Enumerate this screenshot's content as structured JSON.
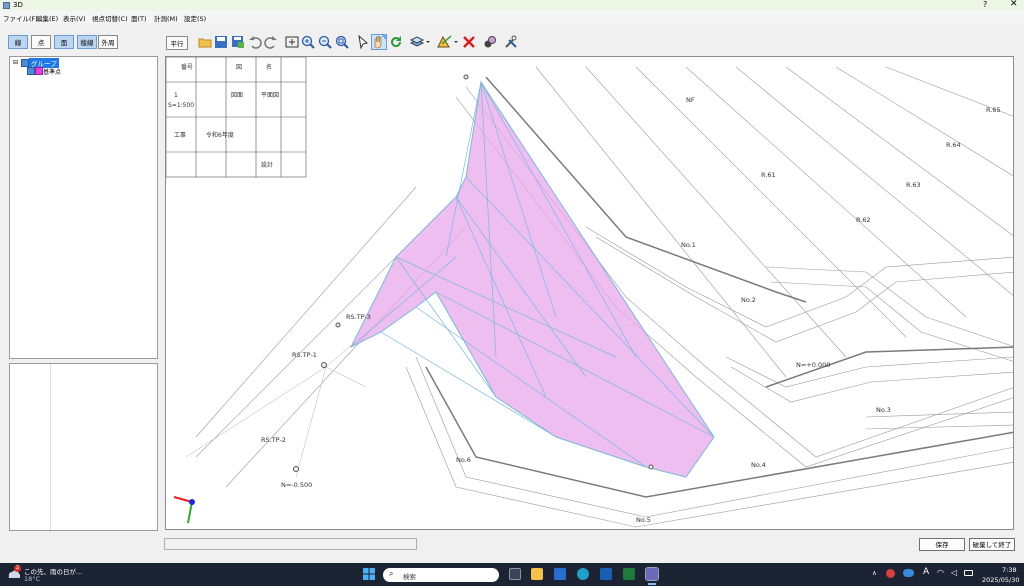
{
  "window": {
    "title": "3D",
    "help_label": "?",
    "close_label": "✕"
  },
  "menu": [
    "ファイル(F)",
    "編集(E)",
    "表示(V)",
    "視点切替(C)",
    "面(T)",
    "計測(M)",
    "設定(S)"
  ],
  "mode_buttons": [
    "線",
    "点",
    "面",
    "稜線",
    "外周"
  ],
  "view_button": "平行",
  "tree": {
    "root": "グループ",
    "child": "基準点"
  },
  "toolbar_icons": [
    "open-folder-icon",
    "save-icon",
    "save-as-icon",
    "undo-icon",
    "redo-icon",
    "fit-view-icon",
    "zoom-in-icon",
    "zoom-out-icon",
    "zoom-window-icon",
    "select-cursor-icon",
    "pan-hand-icon",
    "refresh-icon",
    "layers-icon",
    "surface-edit-icon",
    "delete-icon",
    "render-icon",
    "settings-tools-icon"
  ],
  "drawing": {
    "legend_cells": [
      "番号",
      "図",
      "名",
      "1",
      "S=1:500",
      "図面",
      "平面図",
      "工事",
      "令和6年度",
      "設計"
    ],
    "labels": [
      "RS.TP-1",
      "RS.TP-2",
      "RS.TP-3",
      "No.1",
      "No.2",
      "No.3",
      "No.4",
      "No.5",
      "No.6",
      "NF",
      "R.61",
      "R.62",
      "R.63",
      "R.64",
      "R.65",
      "N=+0.000",
      "N=-0.500"
    ]
  },
  "colors": {
    "surface_fill": "#e8a8ec",
    "surface_edge": "#7ab8d8",
    "accent": "#1e78e6"
  },
  "buttons": {
    "save": "保存",
    "discard_exit": "破棄して終了"
  },
  "taskbar": {
    "weather_text": "この先、雨の日が...",
    "temperature": "18°C",
    "weather_badge": "2",
    "search_placeholder": "検索",
    "time": "7:38",
    "date": "2025/05/30",
    "ime": "A"
  }
}
